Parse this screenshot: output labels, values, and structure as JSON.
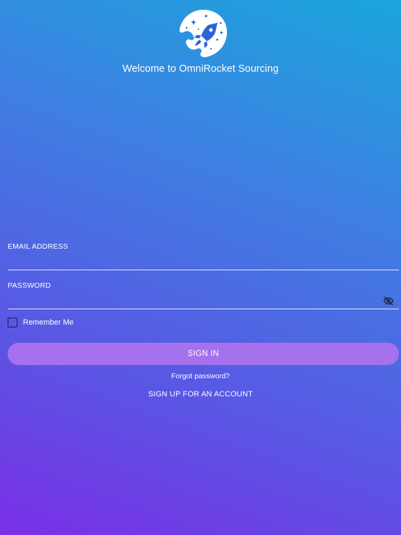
{
  "app": {
    "welcome_text": "Welcome to OmniRocket Sourcing",
    "logo_icon": "rocket-logo-icon"
  },
  "form": {
    "email_label": "EMAIL ADDRESS",
    "email_value": "",
    "password_label": "PASSWORD",
    "password_value": "",
    "password_toggle_icon": "eye-slash-icon",
    "remember_label": "Remember Me",
    "remember_checked": false,
    "signin_label": "SIGN IN",
    "forgot_label": "Forgot password?",
    "signup_label": "SIGN UP FOR AN ACCOUNT"
  },
  "colors": {
    "gradient_top": "#1aa6dc",
    "gradient_bottom": "#7a2fe6",
    "signin_button": "#a571ec",
    "logo_dark": "#2a63d6"
  }
}
